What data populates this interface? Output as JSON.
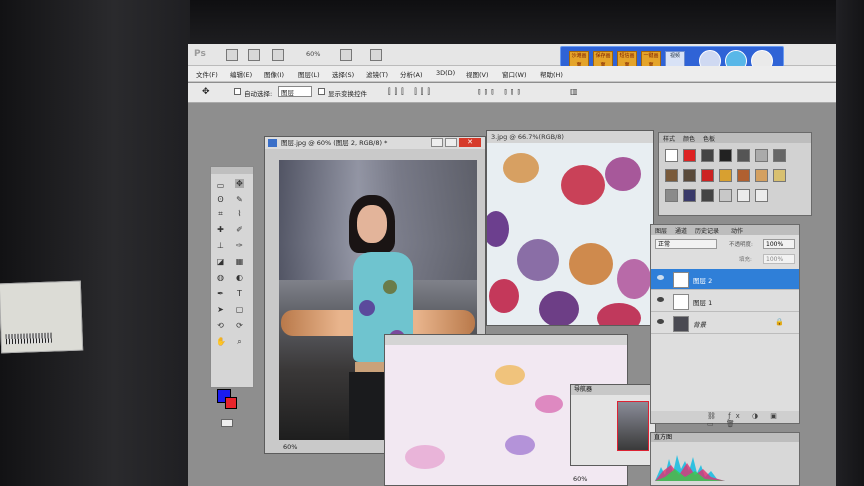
{
  "app": {
    "logo": "Ps",
    "zoom": "60%",
    "menu": [
      "文件(F)",
      "编辑(E)",
      "图像(I)",
      "图层(L)",
      "选择(S)",
      "滤镜(T)",
      "分析(A)",
      "3D(D)",
      "视图(V)",
      "窗口(W)",
      "帮助(H)"
    ]
  },
  "options_bar": {
    "auto_select_label": "自动选择:",
    "auto_select_value": "图层",
    "show_transform_label": "显示变换控件"
  },
  "qq_toolbar": {
    "buttons": [
      "沙滩画面",
      "保存画面",
      "短信画面",
      "一键画面",
      "视频",
      "",
      "",
      ""
    ]
  },
  "documents": {
    "doc1_title": "图层.jpg @ 60% (图层 2, RGB/8) *",
    "doc1_zoom": "60%",
    "doc2_title": "3.jpg @ 66.7%(RGB/8)",
    "doc3_zoom": "60%"
  },
  "navigator": {
    "title": "导航器"
  },
  "styles_panel": {
    "tabs": [
      "样式",
      "颜色",
      "色板"
    ]
  },
  "layers_panel": {
    "tabs": [
      "图层",
      "通道",
      "历史记录",
      "动作"
    ],
    "blend_mode": "正常",
    "opacity_label": "不透明度:",
    "opacity": "100%",
    "fill_label": "填充:",
    "fill": "100%",
    "layers": [
      {
        "name": "图层 2",
        "selected": true
      },
      {
        "name": "图层 1",
        "selected": false
      },
      {
        "name": "背景",
        "selected": false
      }
    ]
  },
  "histogram_panel": {
    "title": "直方图"
  },
  "colors": {
    "foreground": "#1b1bf0",
    "background": "#e8242c",
    "selection": "#2f7fd8"
  }
}
